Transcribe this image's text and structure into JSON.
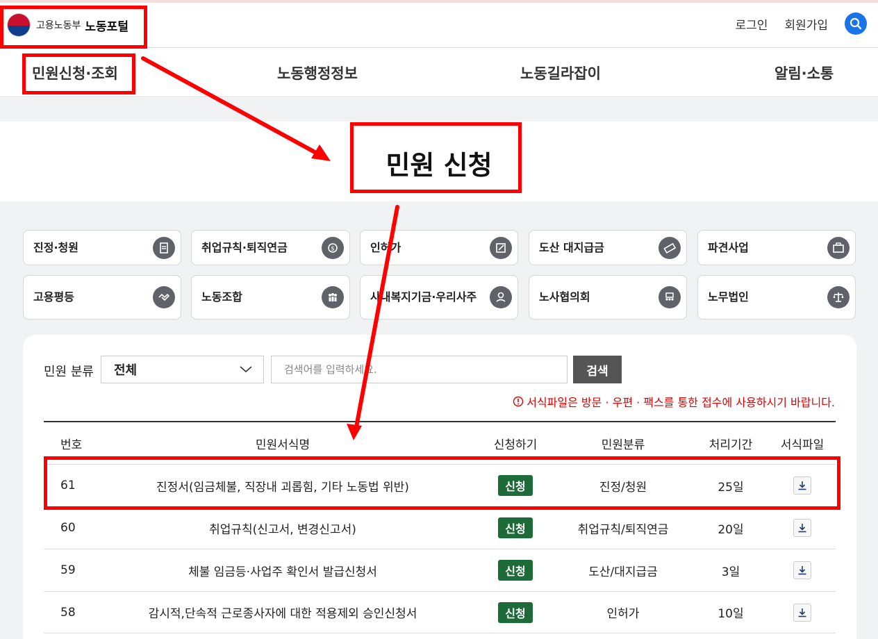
{
  "header": {
    "ministry": "고용노동부",
    "portal": "노동포털",
    "login": "로그인",
    "signup": "회원가입",
    "search_icon": "search-icon"
  },
  "nav": {
    "items": [
      "민원신청·조회",
      "노동행정정보",
      "노동길라잡이",
      "알림·소통"
    ]
  },
  "hero": {
    "title": "민원 신청"
  },
  "categories": [
    {
      "label": "진정·청원",
      "icon": "petition-icon"
    },
    {
      "label": "취업규칙·퇴직연금",
      "icon": "pension-icon"
    },
    {
      "label": "인허가",
      "icon": "license-icon"
    },
    {
      "label": "도산 대지급금",
      "icon": "payment-icon"
    },
    {
      "label": "파견사업",
      "icon": "briefcase-icon"
    },
    {
      "label": "고용평등",
      "icon": "handshake-icon"
    },
    {
      "label": "노동조합",
      "icon": "union-icon"
    },
    {
      "label": "사내복지기금·우리사주",
      "icon": "welfare-icon"
    },
    {
      "label": "노사협의회",
      "icon": "council-icon"
    },
    {
      "label": "노무법인",
      "icon": "scales-icon"
    }
  ],
  "filter": {
    "label": "민원 분류",
    "selected": "전체",
    "placeholder": "검색어를 입력하세요.",
    "search_button": "검색",
    "notice": "서식파일은 방문 · 우편 · 팩스를 통한 접수에 사용하시기 바랍니다."
  },
  "table": {
    "headers": [
      "번호",
      "민원서식명",
      "신청하기",
      "민원분류",
      "처리기간",
      "서식파일"
    ],
    "apply_label": "신청",
    "rows": [
      {
        "no": "61",
        "title": "진정서(임금체불, 직장내 괴롭힘, 기타 노동법 위반)",
        "type": "진정/청원",
        "period": "25일"
      },
      {
        "no": "60",
        "title": "취업규칙(신고서, 변경신고서)",
        "type": "취업규칙/퇴직연금",
        "period": "20일"
      },
      {
        "no": "59",
        "title": "체불 임금등·사업주 확인서 발급신청서",
        "type": "도산/대지급금",
        "period": "3일"
      },
      {
        "no": "58",
        "title": "감시적,단속적 근로종사자에 대한 적용제외 승인신청서",
        "type": "인허가",
        "period": "10일"
      }
    ]
  },
  "colors": {
    "accent": "#1a73e8",
    "apply_badge": "#1e6b3a",
    "annotation": "#ff0000",
    "notice": "#e00000"
  }
}
